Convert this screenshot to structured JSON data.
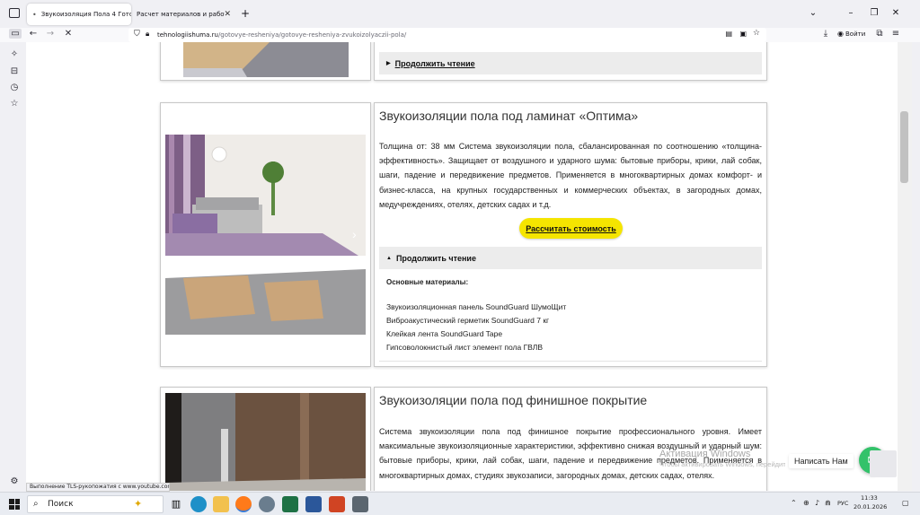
{
  "browser": {
    "tabs": [
      {
        "title": "Звукоизоляция Пола 4 Готов...",
        "active": true
      },
      {
        "title": "Расчет материалов и работ - 2026",
        "active": false
      }
    ],
    "new_tab_icon": "plus-icon",
    "url_host": "tehnologiishuma.ru",
    "url_path": "/gotovye-resheniya/gotovye-resheniya-zvukoizolyaczii-pola/",
    "login_label": "Войти",
    "status_text": "Выполнение TLS-рукопожатия с www.youtube.com..."
  },
  "page": {
    "top_card": {
      "read_more": "Продолжить чтение"
    },
    "laminate_card": {
      "title": "Звукоизоляции пола под ламинат «Оптима»",
      "description": "Толщина от: 38 мм Система звукоизоляции пола, сбалансированная по соотношению «толщина-эффективность». Защищает от воздушного и ударного шума: бытовые приборы, крики, лай собак, шаги, падение и передвижение предметов. Применяется в многоквартирных домах комфорт- и бизнес-класса, на крупных государственных и коммерческих объектах, в загородных домах, медучреждениях, отелях, детских садах и т.д.",
      "calc_button": "Рассчитать стоимость",
      "read_more": "Продолжить чтение",
      "materials_title": "Основные материалы:",
      "materials": [
        "Звукоизоляционная панель SoundGuard ШумоЩит",
        "Виброакустический герметик SoundGuard 7 кг",
        "Клейкая лента SoundGuard Tape",
        "Гипсоволокнистый лист элемент пола ГВЛВ"
      ]
    },
    "finish_card": {
      "title": "Звукоизоляции пола под финишное покрытие",
      "description": "Система звукоизоляции пола под финишное покрытие профессионального уровня. Имеет максимальные звукоизоляционные характеристики, эффективно снижая воздушный и ударный шум: бытовые приборы, крики, лай собак, шаги, падение и передвижение предметов. Применяется в многоквартирных домах, студиях звукозаписи, загородных домах, детских садах, отелях."
    },
    "chat_label": "Написать Нам",
    "watermark_title": "Активация Windows",
    "watermark_sub": "Чтобы активировать Windows, перейдите в раздел «Параметры»."
  },
  "taskbar": {
    "search_placeholder": "Поиск",
    "lang": "РУС",
    "time": "11:33",
    "date": "20.01.2026"
  }
}
